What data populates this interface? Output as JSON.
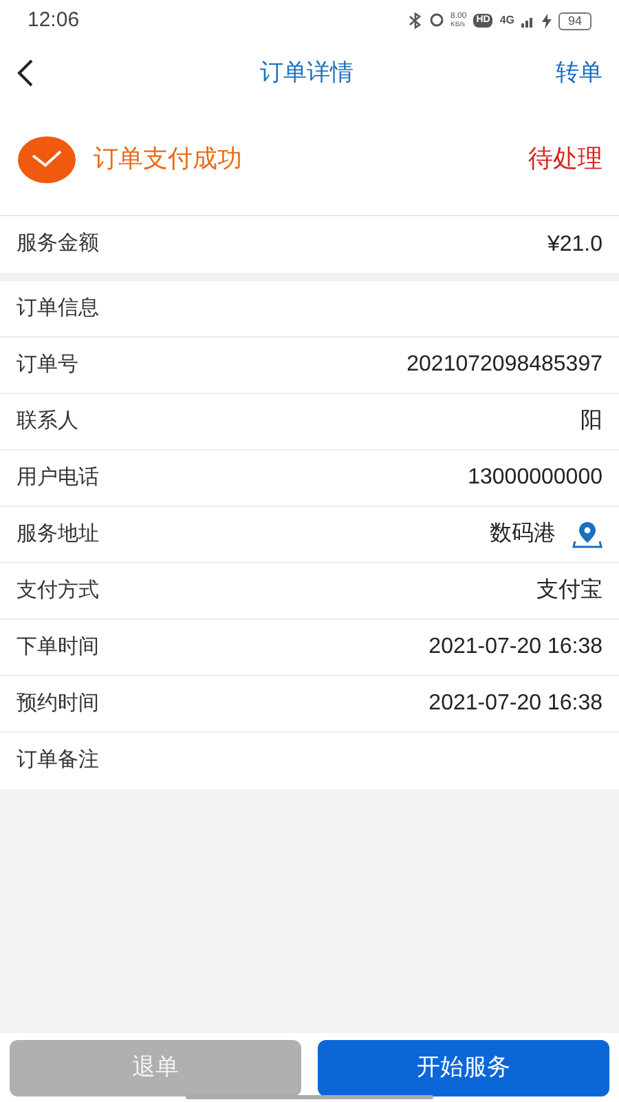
{
  "status_bar": {
    "time": "12:06",
    "speed": "8.00",
    "speed_unit": "KB/s",
    "hd": "HD",
    "network": "4G",
    "battery": "94"
  },
  "header": {
    "title": "订单详情",
    "action": "转单"
  },
  "order_status": {
    "message": "订单支付成功",
    "state": "待处理"
  },
  "amount": {
    "label": "服务金额",
    "value": "¥21.0"
  },
  "info_rows": [
    {
      "kind": "heading",
      "label": "订单信息"
    },
    {
      "kind": "text",
      "label": "订单号",
      "value": "2021072098485397"
    },
    {
      "kind": "text",
      "label": "联系人",
      "value": "阳"
    },
    {
      "kind": "text",
      "label": "用户电话",
      "value": "13000000000"
    },
    {
      "kind": "location",
      "label": "服务地址",
      "value": "数码港"
    },
    {
      "kind": "text",
      "label": "支付方式",
      "value": "支付宝"
    },
    {
      "kind": "text",
      "label": "下单时间",
      "value": "2021-07-20 16:38"
    },
    {
      "kind": "text",
      "label": "预约时间",
      "value": "2021-07-20 16:38"
    },
    {
      "kind": "heading",
      "label": "订单备注"
    }
  ],
  "buttons": [
    {
      "label": "退单",
      "disabled": true
    },
    {
      "label": "开始服务",
      "disabled": false
    }
  ]
}
